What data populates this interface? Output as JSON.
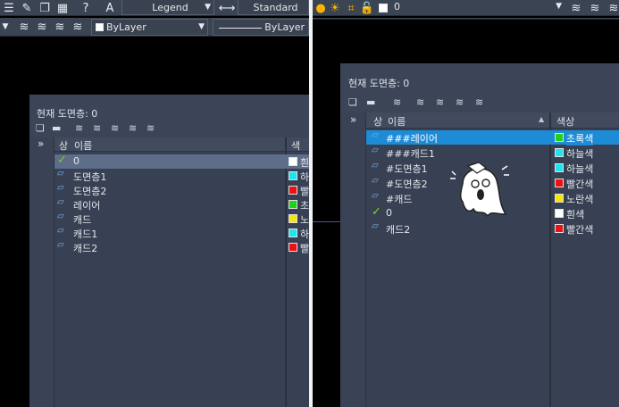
{
  "left": {
    "toolbar1": {
      "text_style": "Legend",
      "table_style": "Standard"
    },
    "toolbar2": {
      "color": "ByLayer",
      "linetype": "ByLayer"
    },
    "palette": {
      "title": "현재 도면층: 0",
      "header_status": "상",
      "header_name": "이름",
      "header_color": "색상",
      "expand": "»",
      "rows": [
        {
          "status": "check",
          "name": "0",
          "color_name": "흰",
          "color": "#ffffff",
          "selected": true
        },
        {
          "status": "layer",
          "name": "도면층1",
          "color_name": "하",
          "color": "#1de5ef",
          "selected": false
        },
        {
          "status": "layer",
          "name": "도면층2",
          "color_name": "빨",
          "color": "#ee1111",
          "selected": false
        },
        {
          "status": "layer",
          "name": "레이어",
          "color_name": "초",
          "color": "#1ed21a",
          "selected": false
        },
        {
          "status": "layer",
          "name": "캐드",
          "color_name": "노",
          "color": "#f3e60a",
          "selected": false
        },
        {
          "status": "layer",
          "name": "캐드1",
          "color_name": "하",
          "color": "#1de5ef",
          "selected": false
        },
        {
          "status": "layer",
          "name": "캐드2",
          "color_name": "빨",
          "color": "#ee1111",
          "selected": false
        }
      ]
    }
  },
  "right": {
    "toolbar1": {
      "current_layer": "0"
    },
    "palette": {
      "title": "현재 도면층: 0",
      "header_status": "상",
      "header_name": "이름",
      "header_color": "색상",
      "expand": "»",
      "rows": [
        {
          "status": "layer",
          "name": "###레이어",
          "color_name": "초록색",
          "color": "#1ed21a",
          "selected": true
        },
        {
          "status": "layer",
          "name": "###캐드1",
          "color_name": "하늘색",
          "color": "#1de5ef",
          "selected": false
        },
        {
          "status": "layer",
          "name": "#도면층1",
          "color_name": "하늘색",
          "color": "#1de5ef",
          "selected": false
        },
        {
          "status": "layer",
          "name": "#도면층2",
          "color_name": "빨간색",
          "color": "#ee1111",
          "selected": false
        },
        {
          "status": "layer",
          "name": "#캐드",
          "color_name": "노란색",
          "color": "#f3e60a",
          "selected": false
        },
        {
          "status": "check",
          "name": "0",
          "color_name": "흰색",
          "color": "#ffffff",
          "selected": false
        },
        {
          "status": "layer",
          "name": "캐드2",
          "color_name": "빨간색",
          "color": "#ee1111",
          "selected": false
        }
      ]
    }
  }
}
